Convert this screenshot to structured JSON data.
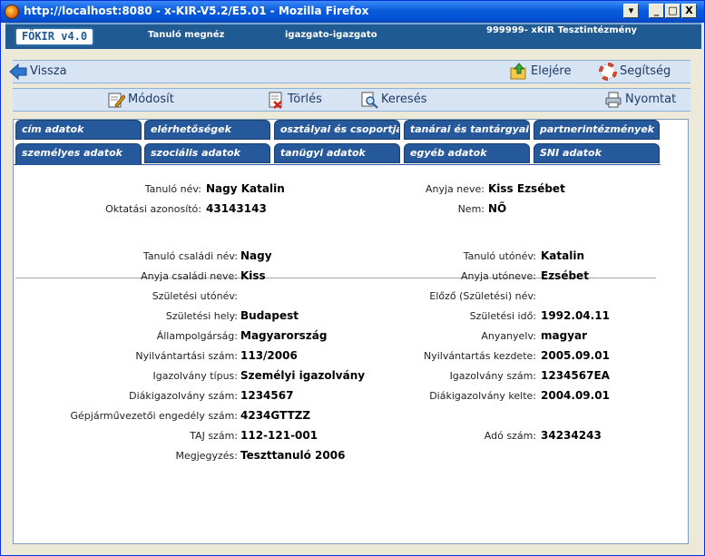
{
  "window": {
    "title": "http://localhost:8080 - x-KIR-V5.2/E5.01 - Mozilla Firefox",
    "minimize": "_",
    "maximize": "□",
    "close": "X"
  },
  "header": {
    "logo": "FÖKIR v4.0",
    "page": "Tanuló megnéz",
    "user": "igazgato-igazgato",
    "institution": "999999- xKIR Tesztintézmény"
  },
  "toolbar": {
    "back": "Vissza",
    "top": "Elejére",
    "help": "Segítség",
    "modify": "Módosít",
    "delete": "Törlés",
    "search": "Keresés",
    "print": "Nyomtat"
  },
  "tabs": {
    "row1": [
      "cím adatok",
      "elérhetőségek",
      "osztályai és csoportjai",
      "tanárai és tantárgyai",
      "partnerintézmények"
    ],
    "row2": [
      "személyes adatok",
      "szociális adatok",
      "tanügyi adatok",
      "egyéb adatok",
      "SNI adatok"
    ],
    "active": "személyes adatok"
  },
  "summary": {
    "name_label": "Tanuló név:",
    "name_value": "Nagy Katalin",
    "mother_label": "Anyja neve:",
    "mother_value": "Kiss Ezsébet",
    "id_label": "Oktatási azonosító:",
    "id_value": "43143143",
    "sex_label": "Nem:",
    "sex_value": "NŐ"
  },
  "details": {
    "left": [
      {
        "label": "Tanuló családi név:",
        "value": "Nagy"
      },
      {
        "label": "Anyja családi neve:",
        "value": "Kiss"
      },
      {
        "label": "Születési utónév:",
        "value": ""
      },
      {
        "label": "Születési hely:",
        "value": "Budapest"
      },
      {
        "label": "Állampolgárság:",
        "value": "Magyarország"
      },
      {
        "label": "Nyilvántartási szám:",
        "value": "113/2006"
      },
      {
        "label": "Igazolvány típus:",
        "value": "Személyi igazolvány"
      },
      {
        "label": "Diákigazolvány szám:",
        "value": "1234567"
      },
      {
        "label": "Gépjárművezetői engedély szám:",
        "value": "4234GTTZZ"
      },
      {
        "label": "TAJ szám:",
        "value": "112-121-001"
      },
      {
        "label": "Megjegyzés:",
        "value": "Teszttanuló 2006"
      }
    ],
    "right": [
      {
        "label": "Tanuló utónév:",
        "value": "Katalin"
      },
      {
        "label": "Anyja utóneve:",
        "value": "Ezsébet"
      },
      {
        "label": "Előző (Születési) név:",
        "value": ""
      },
      {
        "label": "Születési idő:",
        "value": "1992.04.11"
      },
      {
        "label": "Anyanyelv:",
        "value": "magyar"
      },
      {
        "label": "Nyilvántartás kezdete:",
        "value": "2005.09.01"
      },
      {
        "label": "Igazolvány szám:",
        "value": "1234567EA"
      },
      {
        "label": "Diákigazolvány kelte:",
        "value": "2004.09.01"
      },
      {
        "label": "",
        "value": ""
      },
      {
        "label": "Adó szám:",
        "value": "34234243"
      },
      {
        "label": "",
        "value": ""
      }
    ]
  }
}
